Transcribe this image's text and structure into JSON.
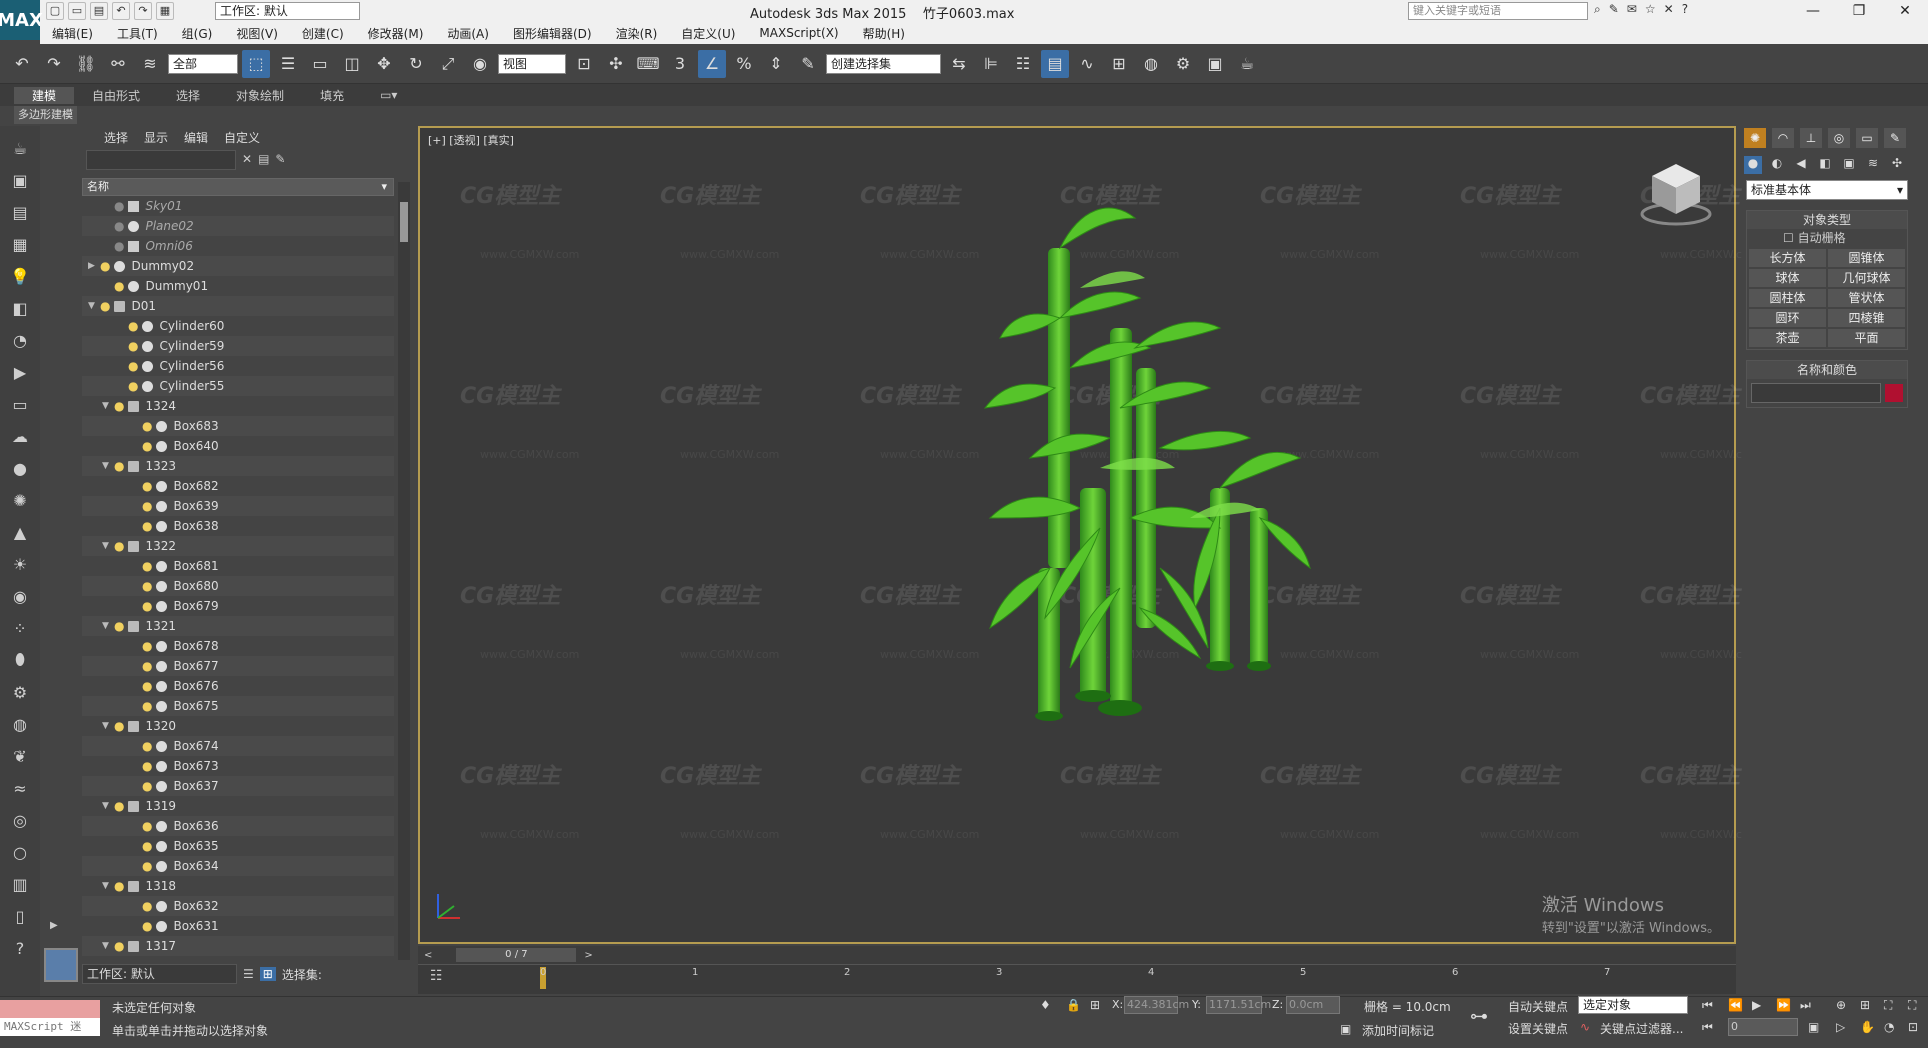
{
  "app": {
    "title": "Autodesk 3ds Max  2015",
    "file": "竹子0603.max",
    "logo": "MAX",
    "workspace": "工作区: 默认",
    "search_placeholder": "键入关键字或短语"
  },
  "menu": [
    "编辑(E)",
    "工具(T)",
    "组(G)",
    "视图(V)",
    "创建(C)",
    "修改器(M)",
    "动画(A)",
    "图形编辑器(D)",
    "渲染(R)",
    "自定义(U)",
    "MAXScript(X)",
    "帮助(H)"
  ],
  "toolbar": {
    "filter": "全部",
    "coord_system": "视图",
    "selection_set": "创建选择集"
  },
  "ribbon": {
    "tabs": [
      "建模",
      "自由形式",
      "选择",
      "对象绘制",
      "填充"
    ],
    "sub": "多边形建模"
  },
  "scene_explorer": {
    "tabs": [
      "选择",
      "显示",
      "编辑",
      "自定义"
    ],
    "column": "名称",
    "rows": [
      {
        "name": "Sky01",
        "indent": 1,
        "dim": true,
        "kind": "light"
      },
      {
        "name": "Plane02",
        "indent": 1,
        "dim": true,
        "kind": "geo"
      },
      {
        "name": "Omni06",
        "indent": 1,
        "dim": true,
        "kind": "light"
      },
      {
        "name": "Dummy02",
        "indent": 0,
        "dim": false,
        "kind": "dummy",
        "exp": "▶"
      },
      {
        "name": "Dummy01",
        "indent": 1,
        "dim": false,
        "kind": "dummy"
      },
      {
        "name": "D01",
        "indent": 0,
        "dim": false,
        "kind": "group",
        "exp": "▼"
      },
      {
        "name": "Cylinder60",
        "indent": 2,
        "kind": "geo"
      },
      {
        "name": "Cylinder59",
        "indent": 2,
        "kind": "geo"
      },
      {
        "name": "Cylinder56",
        "indent": 2,
        "kind": "geo"
      },
      {
        "name": "Cylinder55",
        "indent": 2,
        "kind": "geo"
      },
      {
        "name": "1324",
        "indent": 1,
        "kind": "group",
        "exp": "▼"
      },
      {
        "name": "Box683",
        "indent": 3,
        "kind": "geo"
      },
      {
        "name": "Box640",
        "indent": 3,
        "kind": "geo"
      },
      {
        "name": "1323",
        "indent": 1,
        "kind": "group",
        "exp": "▼"
      },
      {
        "name": "Box682",
        "indent": 3,
        "kind": "geo"
      },
      {
        "name": "Box639",
        "indent": 3,
        "kind": "geo"
      },
      {
        "name": "Box638",
        "indent": 3,
        "kind": "geo"
      },
      {
        "name": "1322",
        "indent": 1,
        "kind": "group",
        "exp": "▼"
      },
      {
        "name": "Box681",
        "indent": 3,
        "kind": "geo"
      },
      {
        "name": "Box680",
        "indent": 3,
        "kind": "geo"
      },
      {
        "name": "Box679",
        "indent": 3,
        "kind": "geo"
      },
      {
        "name": "1321",
        "indent": 1,
        "kind": "group",
        "exp": "▼"
      },
      {
        "name": "Box678",
        "indent": 3,
        "kind": "geo"
      },
      {
        "name": "Box677",
        "indent": 3,
        "kind": "geo"
      },
      {
        "name": "Box676",
        "indent": 3,
        "kind": "geo"
      },
      {
        "name": "Box675",
        "indent": 3,
        "kind": "geo"
      },
      {
        "name": "1320",
        "indent": 1,
        "kind": "group",
        "exp": "▼"
      },
      {
        "name": "Box674",
        "indent": 3,
        "kind": "geo"
      },
      {
        "name": "Box673",
        "indent": 3,
        "kind": "geo"
      },
      {
        "name": "Box637",
        "indent": 3,
        "kind": "geo"
      },
      {
        "name": "1319",
        "indent": 1,
        "kind": "group",
        "exp": "▼"
      },
      {
        "name": "Box636",
        "indent": 3,
        "kind": "geo"
      },
      {
        "name": "Box635",
        "indent": 3,
        "kind": "geo"
      },
      {
        "name": "Box634",
        "indent": 3,
        "kind": "geo"
      },
      {
        "name": "1318",
        "indent": 1,
        "kind": "group",
        "exp": "▼"
      },
      {
        "name": "Box632",
        "indent": 3,
        "kind": "geo"
      },
      {
        "name": "Box631",
        "indent": 3,
        "kind": "geo"
      },
      {
        "name": "1317",
        "indent": 1,
        "kind": "group",
        "exp": "▼"
      }
    ],
    "workspace_bottom": "工作区: 默认",
    "selection_set_label": "选择集:"
  },
  "viewport": {
    "label": "[+] [透视] [真实]",
    "watermark": "CG模型主",
    "watermark_url": "www.CGMXW.com",
    "activate_line1": "激活 Windows",
    "activate_line2": "转到\"设置\"以激活 Windows。"
  },
  "command_panel": {
    "dropdown": "标准基本体",
    "object_type_header": "对象类型",
    "autogrid": "自动栅格",
    "buttons": [
      "长方体",
      "圆锥体",
      "球体",
      "几何球体",
      "圆柱体",
      "管状体",
      "圆环",
      "四棱锥",
      "茶壶",
      "平面"
    ],
    "name_color_header": "名称和颜色",
    "color": "#b01030"
  },
  "timeline": {
    "frame": "0 / 7",
    "ticks": [
      "0",
      "1",
      "2",
      "3",
      "4",
      "5",
      "6",
      "7"
    ],
    "current_frame": 0
  },
  "status": {
    "maxscript": "MAXScript 迷",
    "line1": "未选定任何对象",
    "line2": "单击或单击并拖动以选择对象",
    "x": "424.381cm",
    "y": "1171.51cm",
    "z": "0.0cm",
    "grid": "栅格 = 10.0cm",
    "add_time_tag": "添加时间标记",
    "auto_key": "自动关键点",
    "set_key": "设置关键点",
    "selected": "选定对象",
    "key_filters": "关键点过滤器...",
    "frame_input": "0"
  }
}
